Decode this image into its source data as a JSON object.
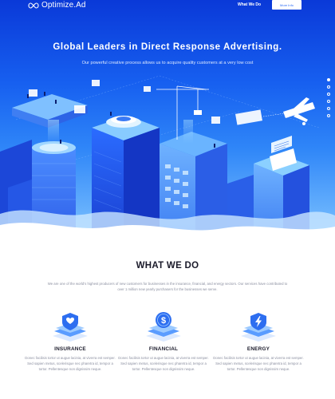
{
  "brand": {
    "name": "Optimize.Ad"
  },
  "nav": {
    "what_we_do": "What We Do",
    "cta_button": "More Info"
  },
  "hero": {
    "title": "Global Leaders in Direct Response Advertising.",
    "subtitle": "Our powerful creative process allows us to acquire quality customers at a very low cost",
    "slide_count": 6,
    "active_slide": 1
  },
  "what_we_do": {
    "title": "WHAT WE DO",
    "description": "We are one of the world's highest producers of new customers for businesses in the insurance, financial, and energy sectors. Our services have contributed to over 1 million new yearly purchasers for the businesses we serve.",
    "features": [
      {
        "name": "INSURANCE",
        "icon": "shield-heart-icon",
        "text": "Donec facilisis tortor ut augue lacinia, at viverra est semper. Sed sapien metus, scelerisque nec pharetra id, tempor a tortor. Pellentesque non dignissim neque."
      },
      {
        "name": "FINANCIAL",
        "icon": "dollar-coin-icon",
        "text": "Donec facilisis tortor ut augue lacinia, at viverra est semper. Sed sapien metus, scelerisque nec pharetra id, tempor a tortor. Pellentesque non dignissim neque."
      },
      {
        "name": "ENERGY",
        "icon": "lightning-bolt-icon",
        "text": "Donec facilisis tortor ut augue lacinia, at viverra est semper. Sed sapien metus, scelerisque nec pharetra id, tempor a tortor. Pellentesque non dignissim neque."
      }
    ]
  },
  "colors": {
    "hero_deep": "#0a39d8",
    "hero_light": "#7fc4ff",
    "accent": "#2f6ef5",
    "text_dark": "#1a1a2a",
    "text_muted": "#8b8fa0"
  }
}
